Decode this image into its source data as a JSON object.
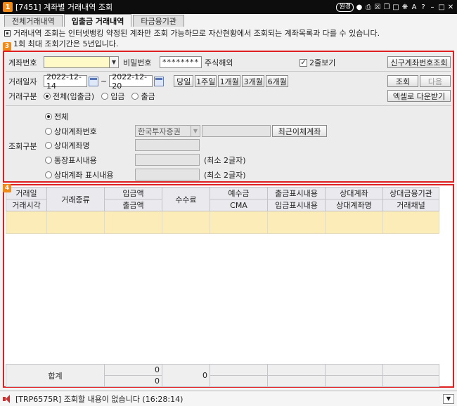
{
  "window": {
    "badge": "1",
    "title": "[7451] 계좌별 거래내역 조회",
    "buttons": [
      "원경"
    ]
  },
  "tabs": [
    {
      "label": "전체거래내역",
      "active": false
    },
    {
      "label": "입출금 거래내역",
      "active": true
    },
    {
      "label": "타금융기관",
      "active": false
    }
  ],
  "notice": {
    "line1": "거래내역 조회는 인터넷뱅킹 약정된 계좌만 조회 가능하므로 자산현황에서 조회되는 계좌목록과 다를 수 있습니다.",
    "line2": "1회 최대 조회기간은 5년입니다."
  },
  "section_numbers": {
    "search": "3",
    "results": "4"
  },
  "search": {
    "account_label": "계좌번호",
    "account_value": "",
    "password_label": "비밀번호",
    "password_value": "********",
    "stock_overseas_label": "주식해외",
    "two_line_label": "2줄보기",
    "two_line_checked": true,
    "new_account_button": "신구계좌번호조회",
    "date_label": "거래일자",
    "date_from": "2022-12-14",
    "date_sep": "~",
    "date_to": "2022-12-20",
    "period_buttons": [
      "당일",
      "1주일",
      "1개월",
      "3개월",
      "6개월"
    ],
    "query_button": "조회",
    "next_button": "다음",
    "excel_button": "엑셀로 다운받기",
    "type_label": "거래구분",
    "type_options": [
      "전체(입출금)",
      "입금",
      "출금"
    ],
    "type_selected": 0,
    "query_type_label": "조회구분",
    "query_options": [
      "전체",
      "상대계좌번호",
      "상대계좌명",
      "통장표시내용",
      "상대계좌 표시내용"
    ],
    "query_selected": 0,
    "bank_value": "한국투자증권",
    "recent_transfer_button": "최근이체계좌",
    "min_chars_note": "(최소 2글자)"
  },
  "grid": {
    "columns": [
      {
        "top": "거래일",
        "bottom": "거래시각"
      },
      {
        "top": "거래종류",
        "bottom": ""
      },
      {
        "top": "입금액",
        "bottom": "출금액"
      },
      {
        "top": "수수료",
        "bottom": ""
      },
      {
        "top": "예수금",
        "bottom": "CMA"
      },
      {
        "top": "출금표시내용",
        "bottom": "입금표시내용"
      },
      {
        "top": "상대계좌",
        "bottom": "상대계좌명"
      },
      {
        "top": "상대금융기관",
        "bottom": "거래채널"
      }
    ],
    "summary": {
      "label": "합계",
      "deposit": "0",
      "withdrawal": "0",
      "fee": "0"
    }
  },
  "status": {
    "message": "[TRP6575R] 조회할 내용이 없습니다 (16:28:14)"
  },
  "colors": {
    "highlight_red": "#e02020",
    "badge_orange": "#f08a18",
    "row_yellow": "#fbecb8"
  }
}
